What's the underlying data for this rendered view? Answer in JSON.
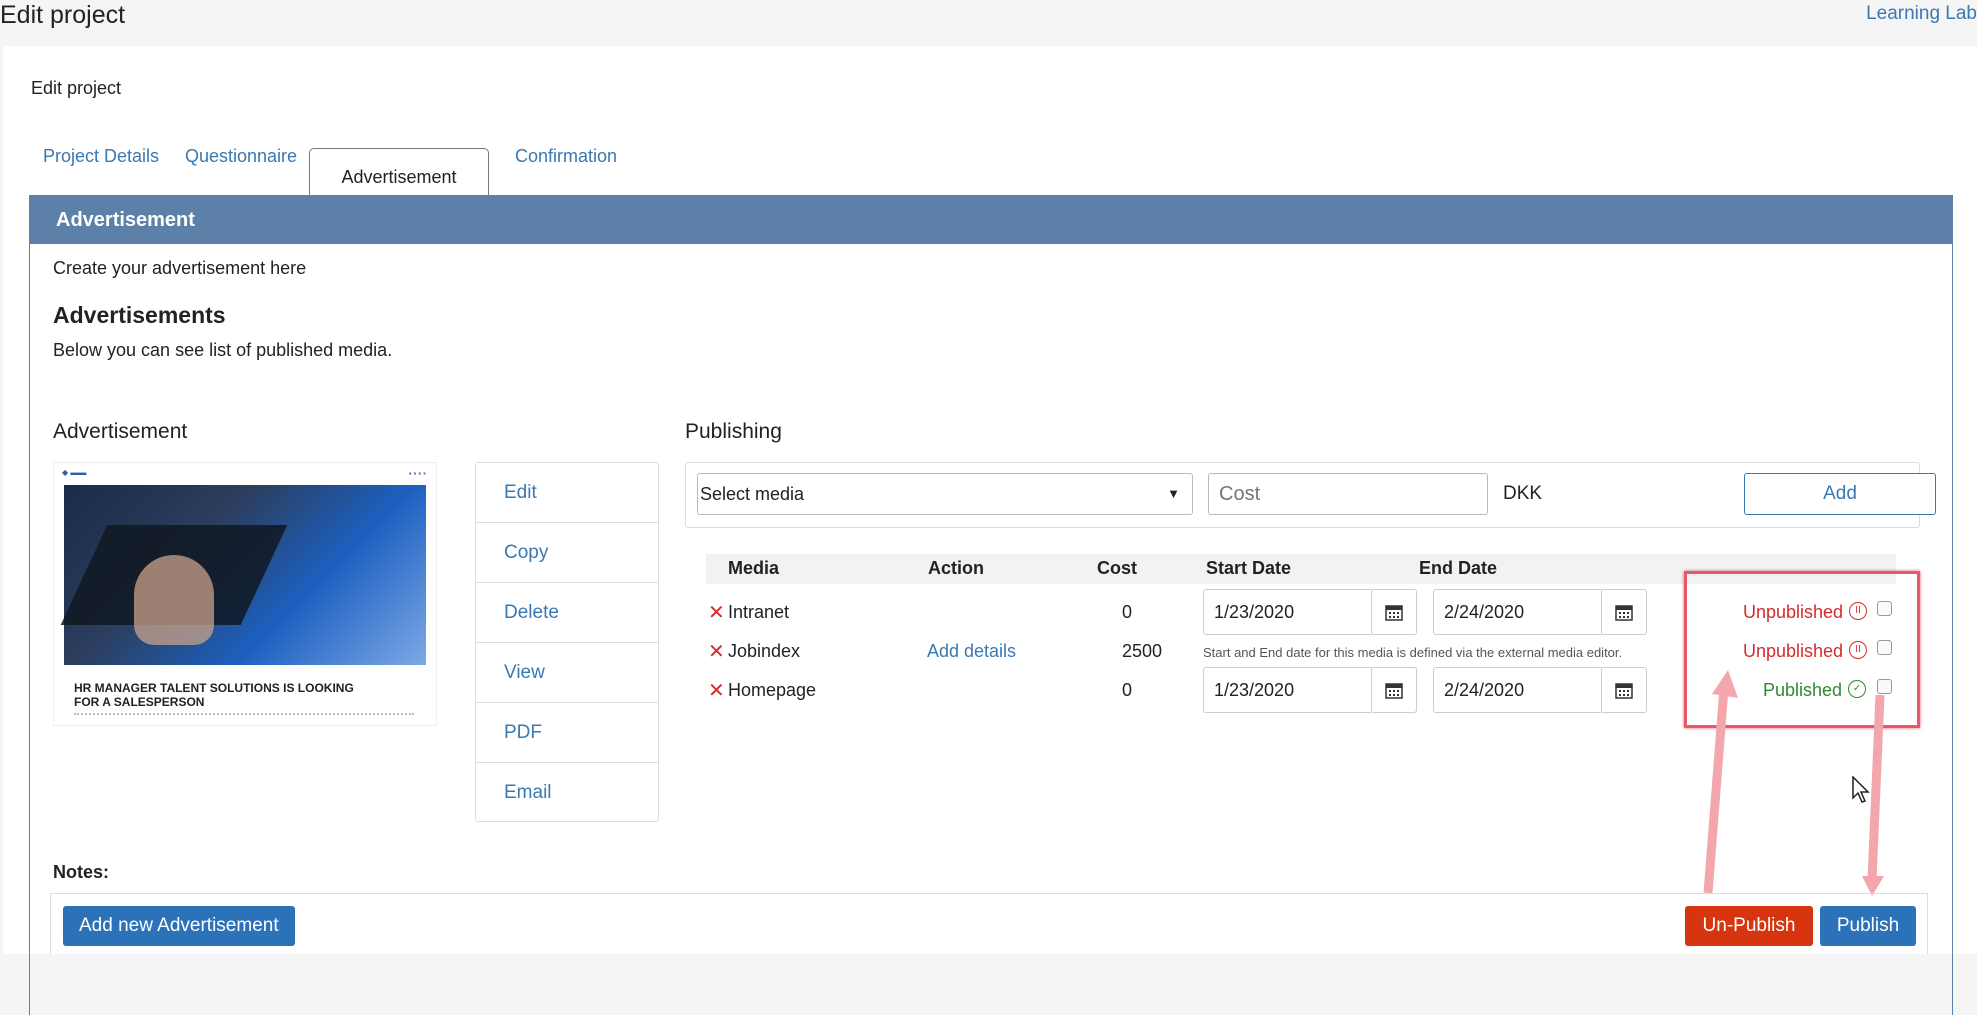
{
  "header": {
    "title": "Edit project",
    "app_link": "Learning Lab"
  },
  "card": {
    "label": "Edit project"
  },
  "tabs": [
    {
      "label": "Project Details",
      "active": false
    },
    {
      "label": "Questionnaire",
      "active": false
    },
    {
      "label": "Advertisement",
      "active": true
    },
    {
      "label": "Confirmation",
      "active": false
    }
  ],
  "panel": {
    "title": "Advertisement",
    "intro": "Create your advertisement here",
    "heading": "Advertisements",
    "subheading": "Below you can see list of published media.",
    "advertisement_label": "Advertisement",
    "publishing_label": "Publishing",
    "notes_label": "Notes:"
  },
  "thumbnail": {
    "headline": "HR MANAGER TALENT SOLUTIONS IS LOOKING FOR A SALESPERSON"
  },
  "ad_actions": [
    {
      "label": "Edit"
    },
    {
      "label": "Copy"
    },
    {
      "label": "Delete"
    },
    {
      "label": "View"
    },
    {
      "label": "PDF"
    },
    {
      "label": "Email"
    }
  ],
  "publishing_form": {
    "media_select": "Select media",
    "cost_placeholder": "Cost",
    "currency": "DKK",
    "add_label": "Add"
  },
  "table": {
    "headers": {
      "media": "Media",
      "action": "Action",
      "cost": "Cost",
      "start_date": "Start Date",
      "end_date": "End Date"
    },
    "rows": [
      {
        "media": "Intranet",
        "action": "",
        "cost": "0",
        "start_date": "1/23/2020",
        "end_date": "2/24/2020",
        "status": "Unpublished",
        "note": ""
      },
      {
        "media": "Jobindex",
        "action": "Add details",
        "cost": "2500",
        "start_date": "",
        "end_date": "",
        "status": "Unpublished",
        "note": "Start and End date for this media is defined via the external media editor."
      },
      {
        "media": "Homepage",
        "action": "",
        "cost": "0",
        "start_date": "1/23/2020",
        "end_date": "2/24/2020",
        "status": "Published",
        "note": ""
      }
    ]
  },
  "footer": {
    "add_new_label": "Add new Advertisement",
    "unpublish_label": "Un-Publish",
    "publish_label": "Publish"
  },
  "colors": {
    "accent": "#5d80a8",
    "link": "#3a78b0",
    "danger": "#d6350f",
    "primary": "#2c72b8",
    "unpublished": "#d62b2b",
    "published": "#2f8a2f",
    "annotation": "#e55a6b"
  },
  "icons": {
    "remove": "x-icon",
    "calendar": "calendar-icon",
    "paused": "pause-circle-icon",
    "published": "check-circle-icon",
    "dropdown": "caret-down-icon"
  }
}
